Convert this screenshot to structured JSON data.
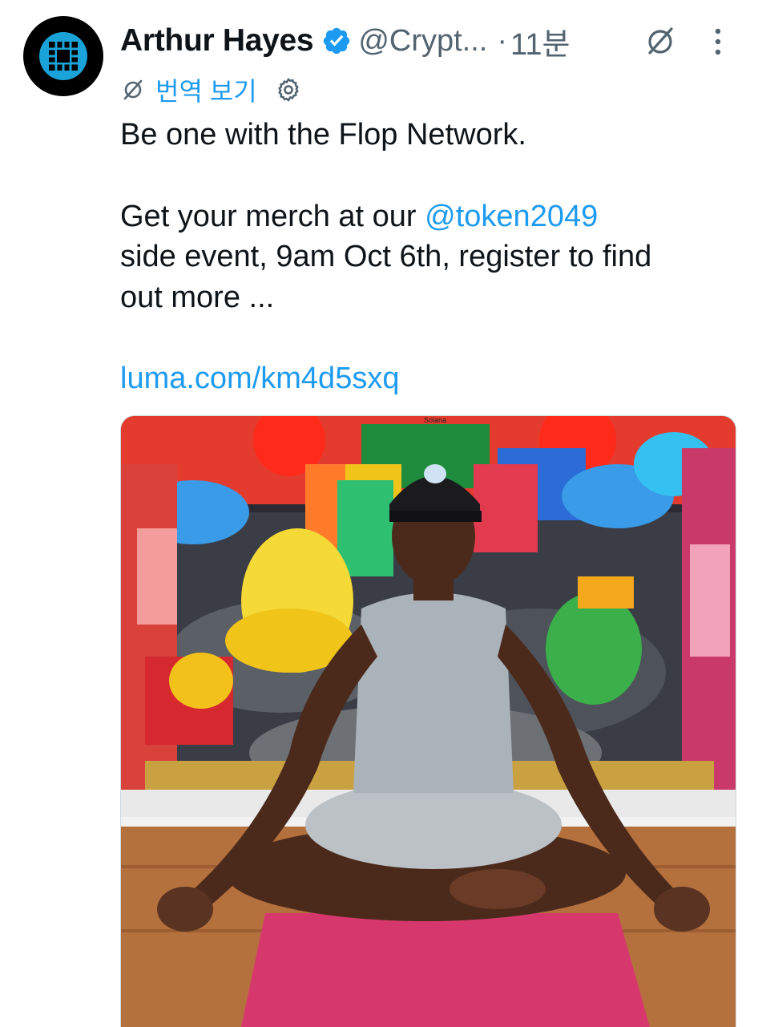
{
  "tweet": {
    "author_name": "Arthur Hayes",
    "handle": "@Crypt...",
    "separator": "·",
    "time": "11분",
    "translate_label": "번역 보기",
    "line1": "Be one with the Flop Network.",
    "line2_prefix": "Get your merch at our ",
    "mention": "@token2049",
    "line3": "side event, 9am Oct 6th, register to find",
    "line4": "out more ...",
    "link": "luma.com/km4d5sxq"
  },
  "media": {
    "description_icon": "photo-person-meditating",
    "cap_text": "Solana"
  },
  "icons": {
    "verified": "verified-badge-icon",
    "grok": "grok-icon",
    "more": "more-options-icon",
    "translate": "translate-icon",
    "settings": "gear-icon"
  },
  "colors": {
    "accent": "#1d9bf0",
    "text": "#0f1419",
    "muted": "#536471"
  }
}
